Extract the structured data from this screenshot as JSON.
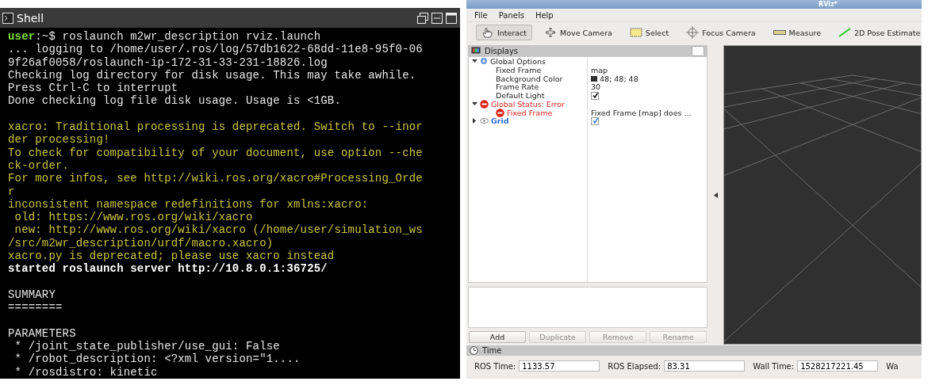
{
  "shell": {
    "title": "Shell",
    "blocks": [
      {
        "lines": [
          {
            "kind": "prompt",
            "user": "user",
            "text": ":~$ roslaunch m2wr_description rviz.launch"
          },
          {
            "kind": "normal",
            "text": "... logging to /home/user/.ros/log/57db1622-68dd-11e8-95f0-06"
          },
          {
            "kind": "normal",
            "text": "9f26af0058/roslaunch-ip-172-31-33-231-18826.log"
          },
          {
            "kind": "normal",
            "text": "Checking log directory for disk usage. This may take awhile."
          },
          {
            "kind": "normal",
            "text": "Press Ctrl-C to interrupt"
          },
          {
            "kind": "normal",
            "text": "Done checking log file disk usage. Usage is <1GB."
          }
        ]
      },
      {
        "lines": [
          {
            "kind": "warning",
            "text": "xacro: Traditional processing is deprecated. Switch to --inor"
          },
          {
            "kind": "warning",
            "text": "der processing!"
          },
          {
            "kind": "warning",
            "text": "To check for compatibility of your document, use option --che"
          },
          {
            "kind": "warning",
            "text": "ck-order."
          },
          {
            "kind": "warning",
            "text": "For more infos, see http://wiki.ros.org/xacro#Processing_Orde"
          },
          {
            "kind": "warning",
            "text": "r"
          },
          {
            "kind": "warning",
            "text": "inconsistent namespace redefinitions for xmlns:xacro:"
          },
          {
            "kind": "warning",
            "text": " old: https://www.ros.org/wiki/xacro"
          },
          {
            "kind": "warning",
            "text": " new: http://www.ros.org/wiki/xacro (/home/user/simulation_ws"
          },
          {
            "kind": "warning",
            "text": "/src/m2wr_description/urdf/macro.xacro)"
          },
          {
            "kind": "warning",
            "text": "xacro.py is deprecated; please use xacro instead"
          },
          {
            "kind": "bold",
            "text": "started roslaunch server http://10.8.0.1:36725/"
          }
        ]
      },
      {
        "lines": [
          {
            "kind": "normal",
            "text": "SUMMARY"
          },
          {
            "kind": "normal",
            "text": "========"
          }
        ]
      },
      {
        "lines": [
          {
            "kind": "normal",
            "text": "PARAMETERS"
          },
          {
            "kind": "normal",
            "text": " * /joint_state_publisher/use_gui: False"
          },
          {
            "kind": "normal",
            "text": " * /robot_description: <?xml version=\"1...."
          },
          {
            "kind": "normal",
            "text": " * /rosdistro: kinetic"
          }
        ]
      }
    ]
  },
  "rviz": {
    "title": "RViz*",
    "menu": [
      "File",
      "Panels",
      "Help"
    ],
    "tools": [
      {
        "kind": "interact",
        "label": "Interact",
        "selected": true
      },
      {
        "kind": "move",
        "label": "Move Camera",
        "selected": false
      },
      {
        "kind": "select",
        "label": "Select",
        "selected": false
      },
      {
        "kind": "focus",
        "label": "Focus Camera",
        "selected": false
      },
      {
        "kind": "measure",
        "label": "Measure",
        "selected": false
      },
      {
        "kind": "pose",
        "label": "2D Pose Estimate",
        "selected": false
      }
    ],
    "displays": {
      "title": "Displays",
      "tree": [
        {
          "kind": "options",
          "label": "Global Options",
          "expanded": true,
          "children": [
            {
              "kind": "text",
              "label": "Fixed Frame",
              "value": "map"
            },
            {
              "kind": "color",
              "label": "Background Color",
              "value": "48; 48; 48"
            },
            {
              "kind": "text",
              "label": "Frame Rate",
              "value": "30"
            },
            {
              "kind": "bool",
              "label": "Default Light",
              "checked": true
            }
          ]
        },
        {
          "kind": "error",
          "label": "Global Status: Error",
          "expanded": true,
          "children": [
            {
              "kind": "error",
              "label": "Fixed Frame",
              "value": "Fixed Frame [map] does ..."
            }
          ]
        },
        {
          "kind": "display",
          "label": "Grid",
          "expanded": false,
          "checked": true
        }
      ],
      "buttons": [
        {
          "label": "Add",
          "disabled": false
        },
        {
          "label": "Duplicate",
          "disabled": true
        },
        {
          "label": "Remove",
          "disabled": true
        },
        {
          "label": "Rename",
          "disabled": true
        }
      ]
    },
    "time": {
      "title": "Time",
      "fields": [
        {
          "label": "ROS Time:",
          "value": "1133.57"
        },
        {
          "label": "ROS Elapsed:",
          "value": "83.31"
        },
        {
          "label": "Wall Time:",
          "value": "1528217221.45"
        }
      ],
      "cut_label": "Wa"
    }
  }
}
